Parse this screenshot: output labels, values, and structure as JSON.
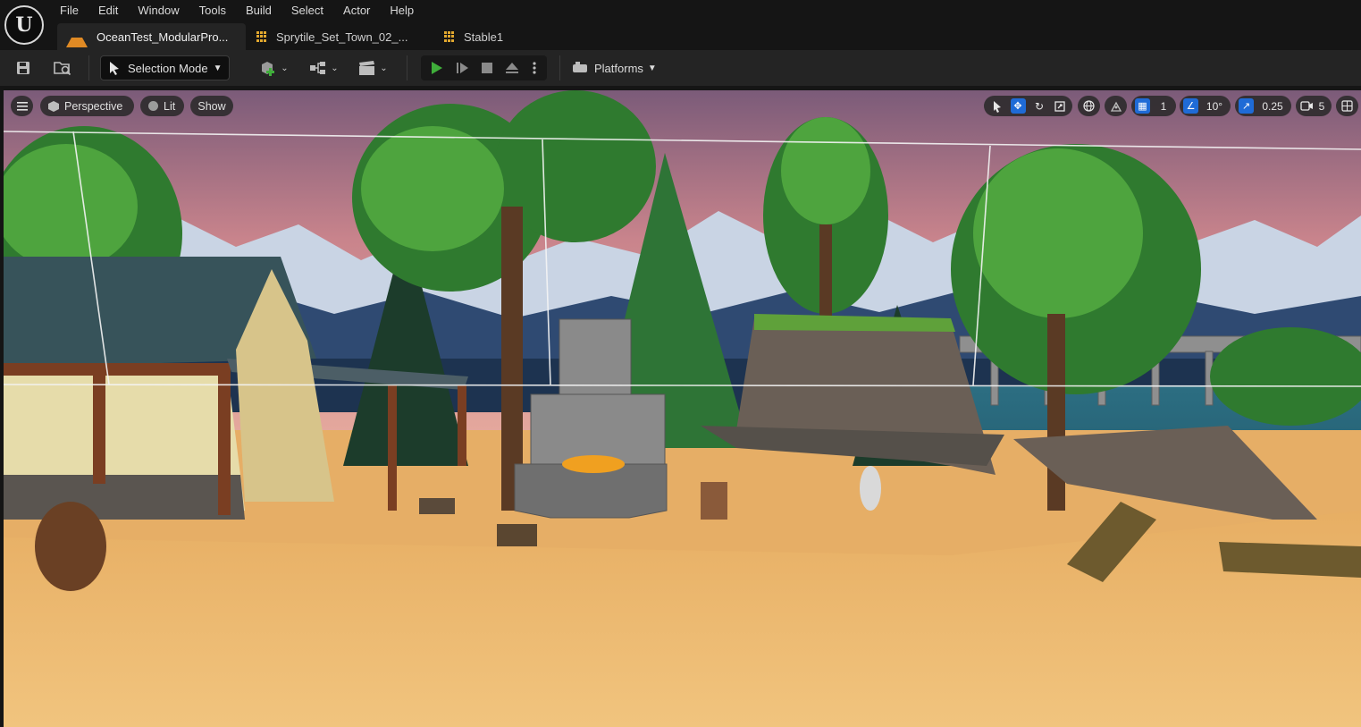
{
  "menu": [
    "File",
    "Edit",
    "Window",
    "Tools",
    "Build",
    "Select",
    "Actor",
    "Help"
  ],
  "tabs": [
    {
      "label": "OceanTest_ModularPro...",
      "icon": "level-icon",
      "active": true
    },
    {
      "label": "Sprytile_Set_Town_02_...",
      "icon": "tileset-grid-icon",
      "active": false
    },
    {
      "label": "Stable1",
      "icon": "tileset-grid-icon",
      "active": false
    }
  ],
  "toolbar": {
    "selection_mode": "Selection Mode",
    "platforms": "Platforms"
  },
  "viewport": {
    "perspective": "Perspective",
    "lit": "Lit",
    "show": "Show",
    "grid_snap": "1",
    "rotation_snap": "10°",
    "scale_snap": "0.25",
    "camera_speed": "5"
  },
  "colors": {
    "accent": "#1f6bd6",
    "play": "#3fae3a",
    "level_tab": "#e08a24"
  }
}
